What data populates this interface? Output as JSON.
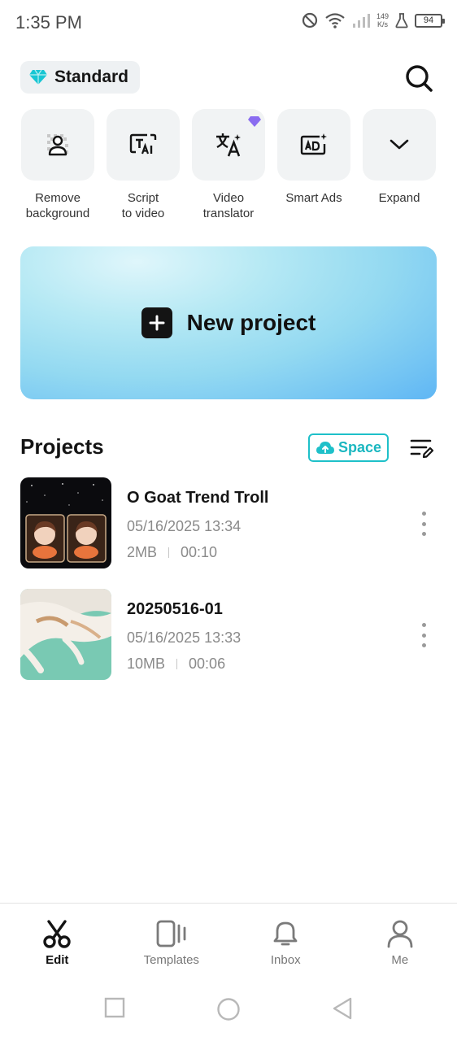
{
  "status_bar": {
    "time": "1:35 PM",
    "net_speed_value": "149",
    "net_speed_unit": "K/s",
    "battery": "94"
  },
  "header": {
    "plan_label": "Standard",
    "search_icon": "search-icon"
  },
  "tools": [
    {
      "label": "Remove background",
      "icon": "remove-background-icon",
      "pro": false
    },
    {
      "label": "Script to video",
      "icon": "script-to-video-icon",
      "pro": false
    },
    {
      "label": "Video translator",
      "icon": "translate-icon",
      "pro": true
    },
    {
      "label": "Smart Ads",
      "icon": "smart-ads-icon",
      "pro": false
    },
    {
      "label": "Expand",
      "icon": "chevron-down-icon",
      "pro": false
    }
  ],
  "new_project": {
    "label": "New project"
  },
  "projects": {
    "title": "Projects",
    "space_label": "Space",
    "items": [
      {
        "name": "O Goat Trend Troll",
        "date": "05/16/2025 13:34",
        "size": "2MB",
        "duration": "00:10"
      },
      {
        "name": "20250516-01",
        "date": "05/16/2025 13:33",
        "size": "10MB",
        "duration": "00:06"
      }
    ]
  },
  "bottom_nav": [
    {
      "label": "Edit",
      "icon": "scissors-icon",
      "active": true
    },
    {
      "label": "Templates",
      "icon": "templates-icon",
      "active": false
    },
    {
      "label": "Inbox",
      "icon": "bell-icon",
      "active": false
    },
    {
      "label": "Me",
      "icon": "person-icon",
      "active": false
    }
  ],
  "colors": {
    "accent": "#1ec0c9",
    "plan_gem": "#18c6d3",
    "pro_gem": "#8a6cf0",
    "banner_start": "#dff6fb",
    "banner_end": "#5fb6f4"
  }
}
